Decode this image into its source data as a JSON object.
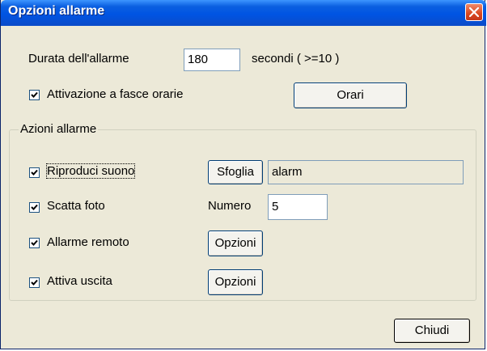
{
  "window": {
    "title": "Opzioni allarme",
    "title_color": "#0054e3",
    "close_icon": "close-icon"
  },
  "duration": {
    "label": "Durata dell'allarme",
    "value": "180",
    "unit": "secondi ( >=10 )"
  },
  "schedule": {
    "checked": true,
    "label": "Attivazione a fasce orarie",
    "button": "Orari"
  },
  "actions": {
    "group_label": "Azioni allarme",
    "sound": {
      "checked": true,
      "label": "Riproduci suono",
      "browse_button": "Sfoglia",
      "file": "alarm"
    },
    "photo": {
      "checked": true,
      "label": "Scatta foto",
      "count_label": "Numero",
      "count": "5"
    },
    "remote": {
      "checked": true,
      "label": "Allarme remoto",
      "button": "Opzioni"
    },
    "output": {
      "checked": true,
      "label": "Attiva uscita",
      "button": "Opzioni"
    }
  },
  "footer": {
    "close_button": "Chiudi"
  }
}
